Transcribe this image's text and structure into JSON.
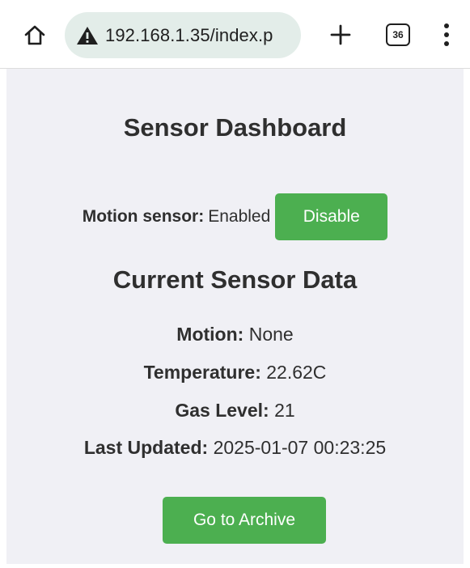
{
  "browser": {
    "url": "192.168.1.35/index.p",
    "tab_count": "36",
    "icons": [
      "home-icon",
      "warning-icon",
      "new-tab-icon",
      "tab-switcher-icon",
      "more-menu-icon"
    ]
  },
  "page": {
    "title": "Sensor Dashboard",
    "motion_sensor": {
      "label": "Motion sensor:",
      "status": "Enabled",
      "button_label": "Disable"
    },
    "current_data": {
      "heading": "Current Sensor Data",
      "motion_label": "Motion:",
      "motion_value": "None",
      "temperature_label": "Temperature:",
      "temperature_value": "22.62C",
      "gas_label": "Gas Level:",
      "gas_value": "21",
      "updated_label": "Last Updated:",
      "updated_value": "2025-01-07 00:23:25"
    },
    "archive_button_label": "Go to Archive"
  },
  "colors": {
    "button_green": "#4caf50",
    "page_background": "#f0f0f5",
    "urlbar_background": "#e3ede9",
    "text": "#2f2f2f"
  }
}
